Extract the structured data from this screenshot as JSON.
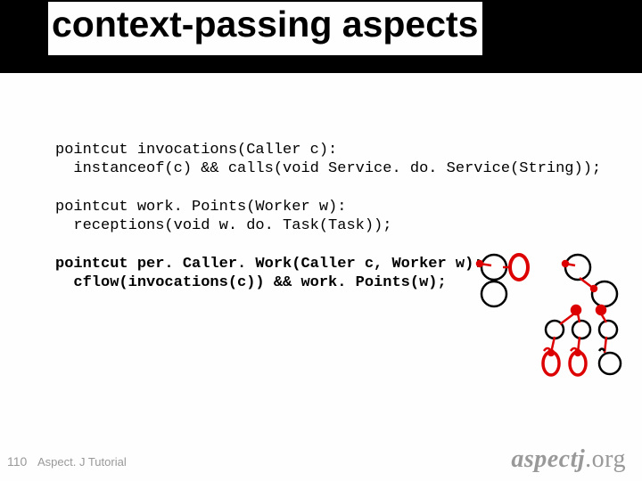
{
  "title": "context-passing aspects",
  "code": {
    "l1": "pointcut invocations(Caller c):",
    "l2": "  instanceof(c) && calls(void Service. do. Service(String));",
    "l3": "",
    "l4": "pointcut work. Points(Worker w):",
    "l5": "  receptions(void w. do. Task(Task));",
    "l6": "",
    "l7": "pointcut per. Caller. Work(Caller c, Worker w):",
    "l8": "  cflow(invocations(c)) && work. Points(w);"
  },
  "slide_number": "110",
  "footer": "Aspect. J Tutorial",
  "logo": {
    "aj": "aspectj",
    "org": ".org"
  }
}
